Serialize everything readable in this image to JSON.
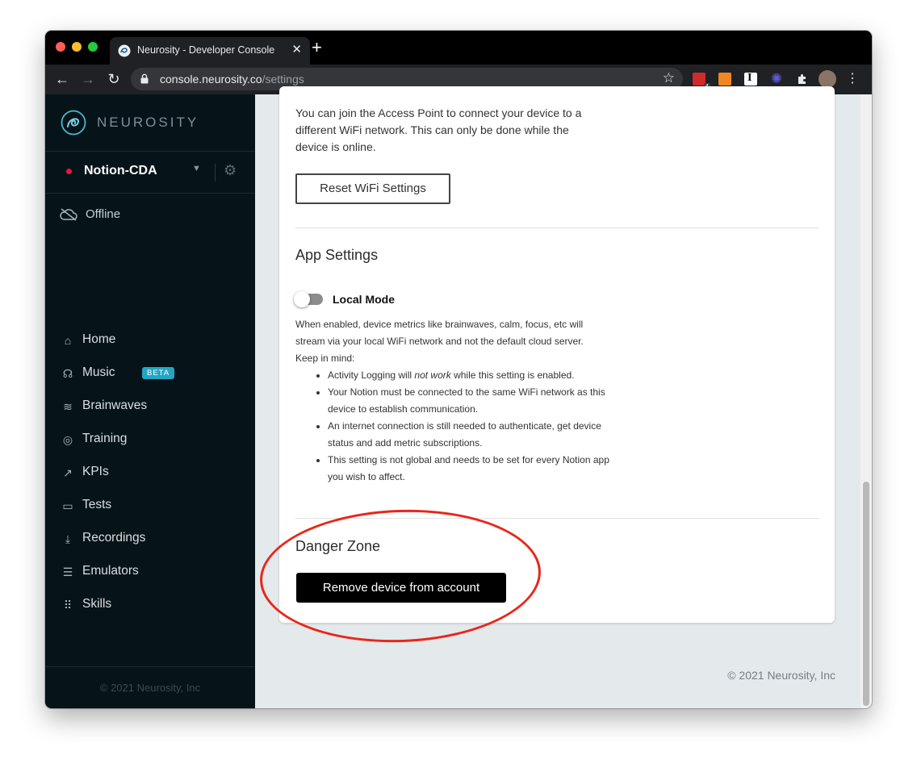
{
  "browser": {
    "tab_title": "Neurosity - Developer Console",
    "url_domain": "console.neurosity.co",
    "url_path": "/settings",
    "extension_badge": "4"
  },
  "sidebar": {
    "logo_text": "NEUROSITY",
    "device_name": "Notion-CDA",
    "status": "Offline",
    "nav": [
      {
        "label": "Home",
        "icon": "home-icon"
      },
      {
        "label": "Music",
        "icon": "headphones-icon",
        "badge": "BETA"
      },
      {
        "label": "Brainwaves",
        "icon": "waves-icon"
      },
      {
        "label": "Training",
        "icon": "fingerprint-icon"
      },
      {
        "label": "KPIs",
        "icon": "trending-up-icon"
      },
      {
        "label": "Tests",
        "icon": "ruler-icon"
      },
      {
        "label": "Recordings",
        "icon": "download-icon"
      },
      {
        "label": "Emulators",
        "icon": "list-icon"
      },
      {
        "label": "Skills",
        "icon": "grid-icon"
      }
    ],
    "footer": "© 2021 Neurosity, Inc"
  },
  "main": {
    "wifi_description": "You can join the Access Point to connect your device to a different WiFi network. This can only be done while the device is online.",
    "reset_wifi_button": "Reset WiFi Settings",
    "app_settings_title": "App Settings",
    "local_mode_label": "Local Mode",
    "local_mode_enabled": false,
    "local_mode_description": "When enabled, device metrics like brainwaves, calm, focus, etc will stream via your local WiFi network and not the default cloud server.",
    "keep_in_mind": "Keep in mind:",
    "notes": {
      "n1_pre": "Activity Logging will ",
      "n1_em": "not work",
      "n1_post": " while this setting is enabled.",
      "n2": "Your Notion must be connected to the same WiFi network as this device to establish communication.",
      "n3": "An internet connection is still needed to authenticate, get device status and add metric subscriptions.",
      "n4": "This setting is not global and needs to be set for every Notion app you wish to affect."
    },
    "danger_zone_title": "Danger Zone",
    "remove_device_button": "Remove device from account",
    "footer": "© 2021 Neurosity, Inc"
  },
  "colors": {
    "sidebar_bg": "#06141a",
    "main_bg": "#e4e9ec",
    "beta_badge": "#22a6c4",
    "device_status_dot": "#e11d35",
    "annotation": "#e8271a"
  }
}
